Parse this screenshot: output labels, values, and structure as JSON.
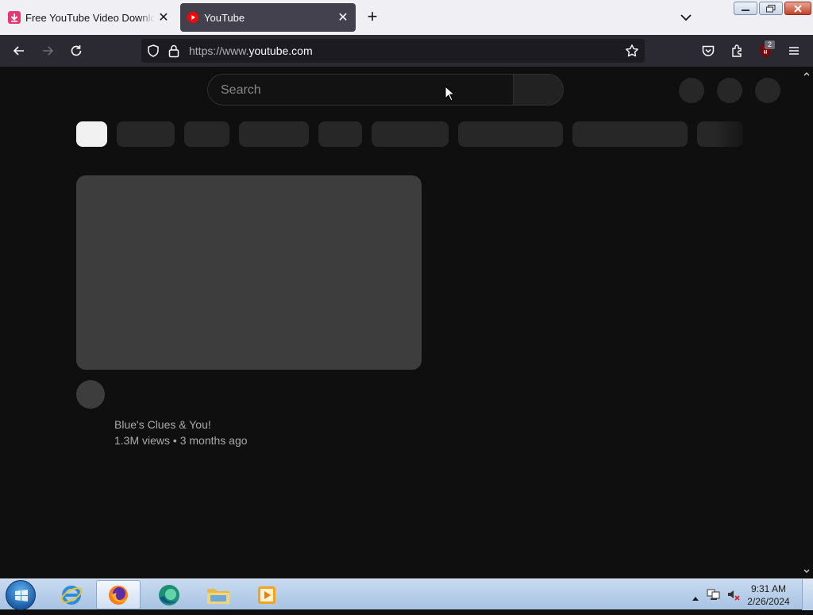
{
  "tabs": [
    {
      "title": "Free YouTube Video Downloader",
      "close": "✕"
    },
    {
      "title": "YouTube",
      "close": "✕"
    }
  ],
  "new_tab": "+",
  "url": {
    "protocol": "https://www.",
    "host": "youtube.com"
  },
  "extension_badge": "2",
  "search": {
    "placeholder": "Search"
  },
  "video": {
    "channel": "Blue's Clues & You!",
    "meta": "1.3M views • 3 months ago"
  },
  "clock": {
    "time": "9:31 AM",
    "date": "2/26/2024"
  },
  "colors": {
    "page_bg": "#0f0f0f",
    "skeleton": "#272727",
    "thumb": "#3d3d3d",
    "chip_active": "#f1f1f1",
    "toolbar": "#2b2a33",
    "tabstrip": "#f0f0f4",
    "yt_red": "#ff0000"
  },
  "icons": [
    "download-icon",
    "youtube-icon",
    "back-icon",
    "forward-icon",
    "reload-icon",
    "shield-icon",
    "lock-icon",
    "star-icon",
    "pocket-icon",
    "extensions-icon",
    "ublock-icon",
    "menu-icon",
    "chevron-down-icon"
  ]
}
